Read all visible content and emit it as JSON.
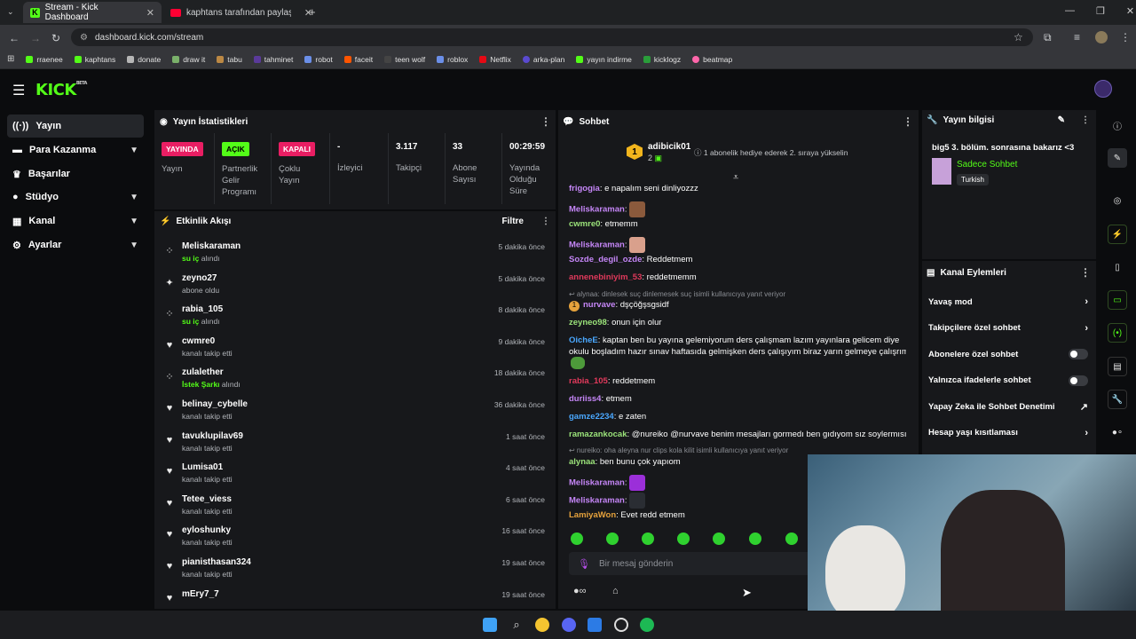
{
  "browser": {
    "tabs": [
      {
        "title": "Stream - Kick Dashboard",
        "active": true
      },
      {
        "title": "kaphtans tarafından paylaşılan",
        "active": false
      }
    ],
    "url": "dashboard.kick.com/stream",
    "bookmarks": [
      "rraenee",
      "kaphtans",
      "donate",
      "draw it",
      "tabu",
      "tahminet",
      "robot",
      "faceit",
      "teen wolf",
      "roblox",
      "Netflix",
      "arka-plan",
      "yayın indirme",
      "kicklogz",
      "beatmap"
    ]
  },
  "app": {
    "logo": "KICK",
    "logo_tag": "BETA"
  },
  "sidebar": {
    "items": [
      {
        "label": "Yayın",
        "icon": "radio-icon",
        "expand": false
      },
      {
        "label": "Para Kazanma",
        "icon": "money-icon",
        "expand": true
      },
      {
        "label": "Başarılar",
        "icon": "trophy-icon",
        "expand": false
      },
      {
        "label": "Stüdyo",
        "icon": "studio-icon",
        "expand": true
      },
      {
        "label": "Kanal",
        "icon": "channel-icon",
        "expand": true
      },
      {
        "label": "Ayarlar",
        "icon": "gear-icon",
        "expand": true
      }
    ]
  },
  "stats": {
    "title": "Yayın İstatistikleri",
    "items": [
      {
        "badge": "YAYINDA",
        "badge_color": "#e91e63",
        "label": "Yayın"
      },
      {
        "badge": "AÇIK",
        "badge_color": "#53fc18",
        "label": "Partnerlik Gelir Programı"
      },
      {
        "badge": "KAPALI",
        "badge_color": "#e91e63",
        "label": "Çoklu Yayın"
      },
      {
        "value": "-",
        "label": "İzleyici"
      },
      {
        "value": "3.117",
        "label": "Takipçi"
      },
      {
        "value": "33",
        "label": "Abone Sayısı"
      },
      {
        "value": "00:29:59",
        "label": "Yayında Olduğu Süre"
      }
    ]
  },
  "activity": {
    "title": "Etkinlik Akışı",
    "filter": "Filtre",
    "items": [
      {
        "name": "Meliskaraman",
        "pre": "",
        "highlight": "su iç",
        "post": " alındı",
        "time": "5 dakika önce",
        "icon": "redeem-icon"
      },
      {
        "name": "zeyno27",
        "pre": "abone oldu",
        "highlight": "",
        "post": "",
        "time": "5 dakika önce",
        "icon": "sparkle-icon"
      },
      {
        "name": "rabia_105",
        "pre": "",
        "highlight": "su iç",
        "post": " alındı",
        "time": "8 dakika önce",
        "icon": "redeem-icon"
      },
      {
        "name": "cwmre0",
        "pre": "kanalı takip etti",
        "highlight": "",
        "post": "",
        "time": "9 dakika önce",
        "icon": "heart-icon"
      },
      {
        "name": "zulalether",
        "pre": "",
        "highlight": "İstek Şarkı",
        "post": " alındı",
        "time": "18 dakika önce",
        "icon": "redeem-icon"
      },
      {
        "name": "belinay_cybelle",
        "pre": "kanalı takip etti",
        "highlight": "",
        "post": "",
        "time": "36 dakika önce",
        "icon": "heart-icon"
      },
      {
        "name": "tavuklupilav69",
        "pre": "kanalı takip etti",
        "highlight": "",
        "post": "",
        "time": "1 saat önce",
        "icon": "heart-icon"
      },
      {
        "name": "Lumisa01",
        "pre": "kanalı takip etti",
        "highlight": "",
        "post": "",
        "time": "4 saat önce",
        "icon": "heart-icon"
      },
      {
        "name": "Tetee_viess",
        "pre": "kanalı takip etti",
        "highlight": "",
        "post": "",
        "time": "6 saat önce",
        "icon": "heart-icon"
      },
      {
        "name": "eyloshunky",
        "pre": "kanalı takip etti",
        "highlight": "",
        "post": "",
        "time": "16 saat önce",
        "icon": "heart-icon"
      },
      {
        "name": "pianisthasan324",
        "pre": "kanalı takip etti",
        "highlight": "",
        "post": "",
        "time": "19 saat önce",
        "icon": "heart-icon"
      },
      {
        "name": "mEry7_7",
        "pre": "",
        "highlight": "",
        "post": "",
        "time": "19 saat önce",
        "icon": "heart-icon"
      }
    ]
  },
  "chat": {
    "title": "Sohbet",
    "pinned": {
      "rank": "1",
      "user": "adibicik01",
      "count": "2",
      "text": "1 abonelik hediye ederek 2. sıraya yükselin"
    },
    "messages": [
      {
        "user": "frigogia",
        "color": "#c586f7",
        "text": "e napalım seni dinliyozzz"
      },
      {
        "user": "Meliskaraman",
        "color": "#c586f7",
        "text": "",
        "emote": "#8b5a3c"
      },
      {
        "user": "cwmre0",
        "color": "#9be37a",
        "text": "etmemm"
      },
      {
        "user": "Meliskaraman",
        "color": "#c586f7",
        "text": "",
        "emote": "#d9a08c"
      },
      {
        "user": "Sozde_degil_ozde",
        "color": "#c586f7",
        "text": "Reddetmem"
      },
      {
        "user": "annenebiniyim_53",
        "color": "#e0395b",
        "text": "reddetmemm"
      },
      {
        "reply": "alynaa: dinlesek suç dinlemesek suç isimli kullanıcıya yanıt veriyor"
      },
      {
        "user": "nurvave",
        "color": "#c586f7",
        "text": "dşçöğşsgsidf",
        "prefix": "1"
      },
      {
        "user": "zeyneo98",
        "color": "#9be37a",
        "text": "onun için olur"
      },
      {
        "user": "OicheE",
        "color": "#4aa8ff",
        "text": "kaptan ben bu yayına gelemiyorum ders çalışmam lazım yayınlara gelicem diye"
      },
      {
        "cont": "okulu boşladım hazır sınav haftasıda gelmişken ders çalışıyım biraz yarın gelmeye çalışrım"
      },
      {
        "user": "rabia_105",
        "color": "#e0395b",
        "text": "reddetmem"
      },
      {
        "user": "duriiss4",
        "color": "#c586f7",
        "text": "etmem"
      },
      {
        "user": "gamze2234",
        "color": "#4aa8ff",
        "text": "e zaten"
      },
      {
        "user": "ramazankocak",
        "color": "#9be37a",
        "text": "@nureiko @nurvave benim mesajları gormedı ben gıdıyom sız soylermısınız"
      },
      {
        "reply": "nureiko: oha aleyna nur clips kola kilit isimli kullanıcıya yanıt veriyor"
      },
      {
        "user": "alynaa",
        "color": "#9be37a",
        "text": "ben bunu çok yapıom"
      },
      {
        "user": "Meliskaraman",
        "color": "#c586f7",
        "text": "",
        "emote": "#9b2fd9"
      },
      {
        "user": "Meliskaraman",
        "color": "#c586f7",
        "text": "",
        "emote": "#2a2d33"
      },
      {
        "user": "LamiyaWon",
        "color": "#e6a23c",
        "text": "Evet redd etmem"
      }
    ],
    "input_placeholder": "Bir mesaj gönderin"
  },
  "stream_info": {
    "title": "Yayın bilgisi",
    "stream_title": "big5 3. bölüm. sonrasına bakarız <3",
    "category": "Sadece Sohbet",
    "language": "Turkish"
  },
  "channel_actions": {
    "title": "Kanal Eylemleri",
    "items": [
      {
        "label": "Yavaş mod",
        "control": "arrow"
      },
      {
        "label": "Takipçilere özel sohbet",
        "control": "arrow"
      },
      {
        "label": "Abonelere özel sohbet",
        "control": "toggle"
      },
      {
        "label": "Yalnızca ifadelerle sohbet",
        "control": "toggle"
      },
      {
        "label": "Yapay Zeka ile Sohbet Denetimi",
        "control": "external"
      },
      {
        "label": "Hesap yaşı kısıtlaması",
        "control": "arrow"
      }
    ]
  },
  "colors": {
    "accent": "#53fc18",
    "live": "#e91e63"
  }
}
